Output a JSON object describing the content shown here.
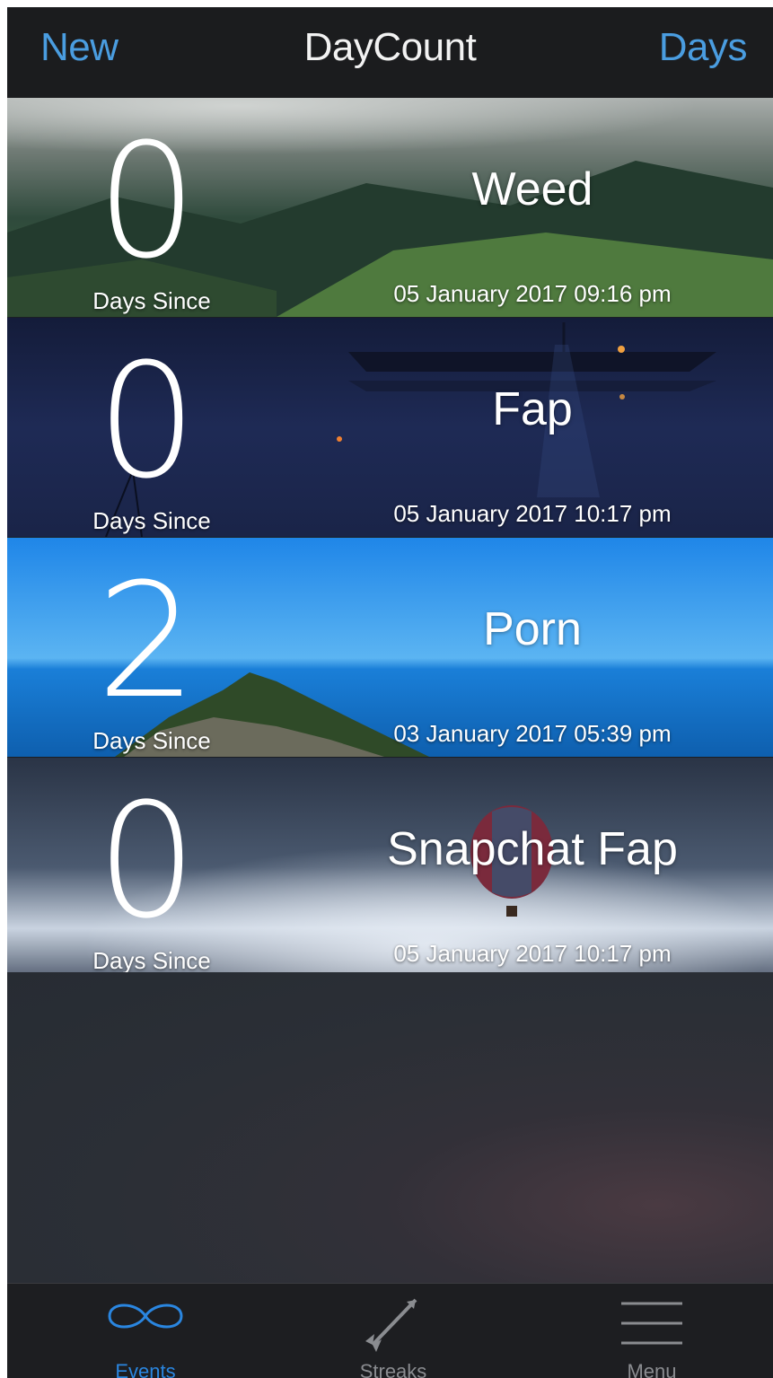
{
  "nav": {
    "left_label": "New",
    "title": "DayCount",
    "right_label": "Days"
  },
  "events": [
    {
      "count": "0",
      "count_label": "Days Since",
      "name": "Weed",
      "date": "05 January 2017 09:16 pm",
      "background": "misty-forest-hills"
    },
    {
      "count": "0",
      "count_label": "Days Since",
      "name": "Fap",
      "date": "05 January 2017 10:17 pm",
      "background": "night-boat-on-water"
    },
    {
      "count": "2",
      "count_label": "Days Since",
      "name": "Porn",
      "date": "03 January 2017 05:39 pm",
      "background": "blue-sea-island"
    },
    {
      "count": "0",
      "count_label": "Days Since",
      "name": "Snapchat Fap",
      "date": "05 January 2017 10:17 pm",
      "background": "hot-air-balloon-starry-sky"
    }
  ],
  "tabbar": {
    "items": [
      {
        "label": "Events",
        "icon": "infinity-icon",
        "active": true
      },
      {
        "label": "Streaks",
        "icon": "arrow-icon",
        "active": false
      },
      {
        "label": "Menu",
        "icon": "hamburger-menu-icon",
        "active": false
      }
    ]
  },
  "colors": {
    "accent": "#2a86e0",
    "nav_background": "#1b1c1e",
    "tab_background": "#1d1e21"
  }
}
